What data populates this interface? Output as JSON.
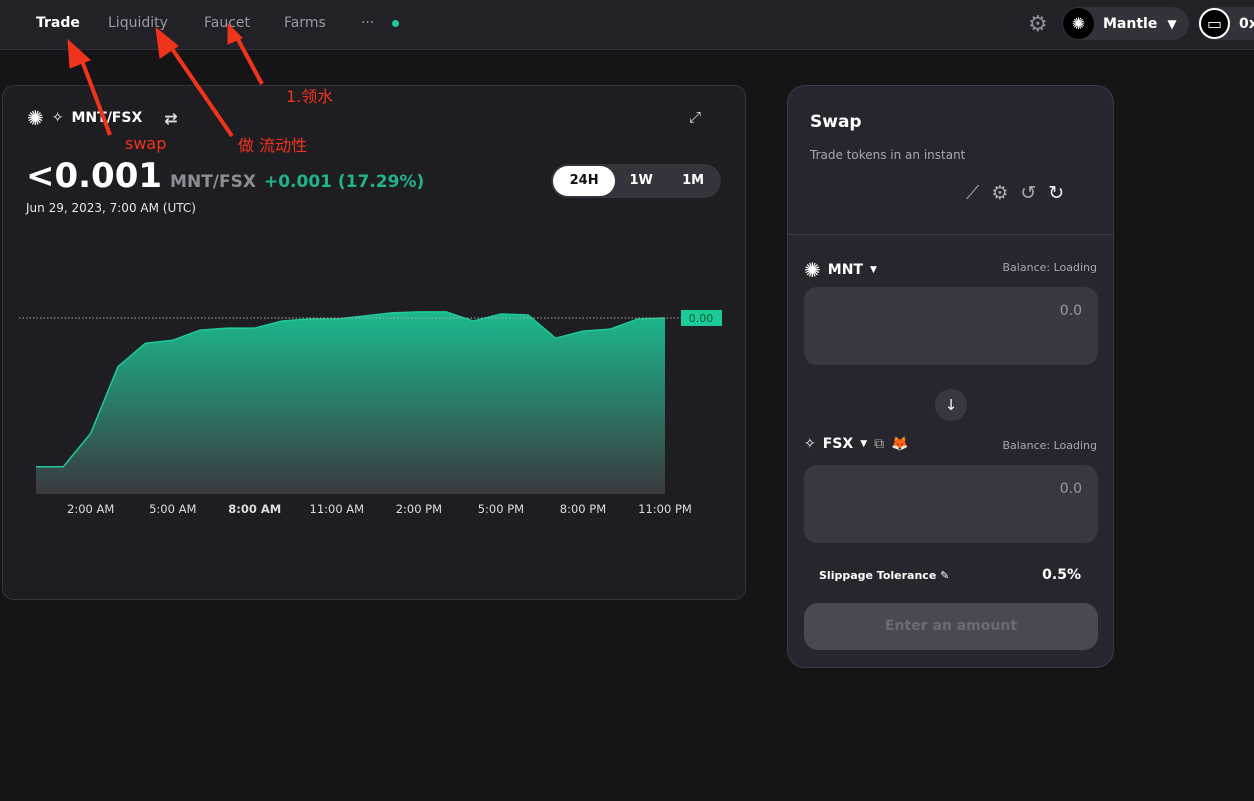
{
  "nav": {
    "items": [
      {
        "label": "Trade",
        "active": true
      },
      {
        "label": "Liquidity"
      },
      {
        "label": "Faucet"
      },
      {
        "label": "Farms"
      }
    ],
    "more": "···",
    "network": "Mantle",
    "wallet": "0x"
  },
  "chart_card": {
    "pair": "MNT/FSX",
    "price": "<0.001",
    "price_pair": "MNT/FSX",
    "change": "+0.001 (17.29%)",
    "date": "Jun 29, 2023, 7:00 AM (UTC)",
    "ranges": [
      "24H",
      "1W",
      "1M"
    ],
    "selected_range": "24H"
  },
  "chart_data": {
    "type": "area",
    "x": [
      "12:00 AM",
      "1:00 AM",
      "2:00 AM",
      "3:00 AM",
      "4:00 AM",
      "5:00 AM",
      "6:00 AM",
      "7:00 AM",
      "8:00 AM",
      "9:00 AM",
      "10:00 AM",
      "11:00 AM",
      "12:00 PM",
      "1:00 PM",
      "2:00 PM",
      "3:00 PM",
      "4:00 PM",
      "5:00 PM",
      "6:00 PM",
      "7:00 PM",
      "8:00 PM",
      "9:00 PM",
      "10:00 PM",
      "11:00 PM"
    ],
    "values": [
      0.000853,
      0.000853,
      0.000886,
      0.000952,
      0.000975,
      0.000978,
      0.000988,
      0.00099,
      0.00099,
      0.000997,
      0.000999,
      0.000999,
      0.001002,
      0.001005,
      0.001006,
      0.001006,
      0.000997,
      0.001004,
      0.001003,
      0.00098,
      0.000987,
      0.000989,
      0.000999,
      0.001
    ],
    "tick_labels": [
      "2:00 AM",
      "5:00 AM",
      "8:00 AM",
      "11:00 AM",
      "2:00 PM",
      "5:00 PM",
      "8:00 PM",
      "11:00 PM"
    ],
    "highlighted_tick": "8:00 AM",
    "current_label": "0.00",
    "ylim": [
      0.000826,
      0.001086
    ],
    "color": "#1ec99a",
    "grid": false
  },
  "swap": {
    "title": "Swap",
    "subtitle": "Trade tokens in an instant",
    "from": {
      "token": "MNT",
      "balance": "Balance: Loading",
      "value": "0.0"
    },
    "to": {
      "token": "FSX",
      "balance": "Balance: Loading",
      "value": "0.0"
    },
    "slippage_label": "Slippage Tolerance",
    "slippage_value": "0.5%",
    "cta": "Enter an amount"
  },
  "annotations": {
    "swap": "swap",
    "liquidity": "做 流动性",
    "faucet": "1.领水"
  }
}
